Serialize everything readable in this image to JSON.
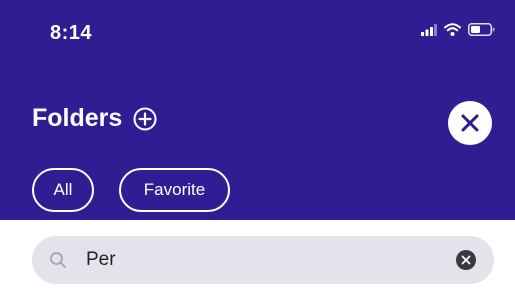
{
  "status_bar": {
    "time": "8:14",
    "icons": [
      "signal-icon",
      "wifi-icon",
      "battery-icon"
    ]
  },
  "header": {
    "title": "Folders",
    "add_icon": "plus-circle-icon",
    "close_icon": "close-icon",
    "background_color": "#2f1d94"
  },
  "filters": [
    {
      "label": "All"
    },
    {
      "label": "Favorite"
    }
  ],
  "search": {
    "value": "Per",
    "search_icon": "search-icon",
    "clear_icon": "clear-icon"
  }
}
